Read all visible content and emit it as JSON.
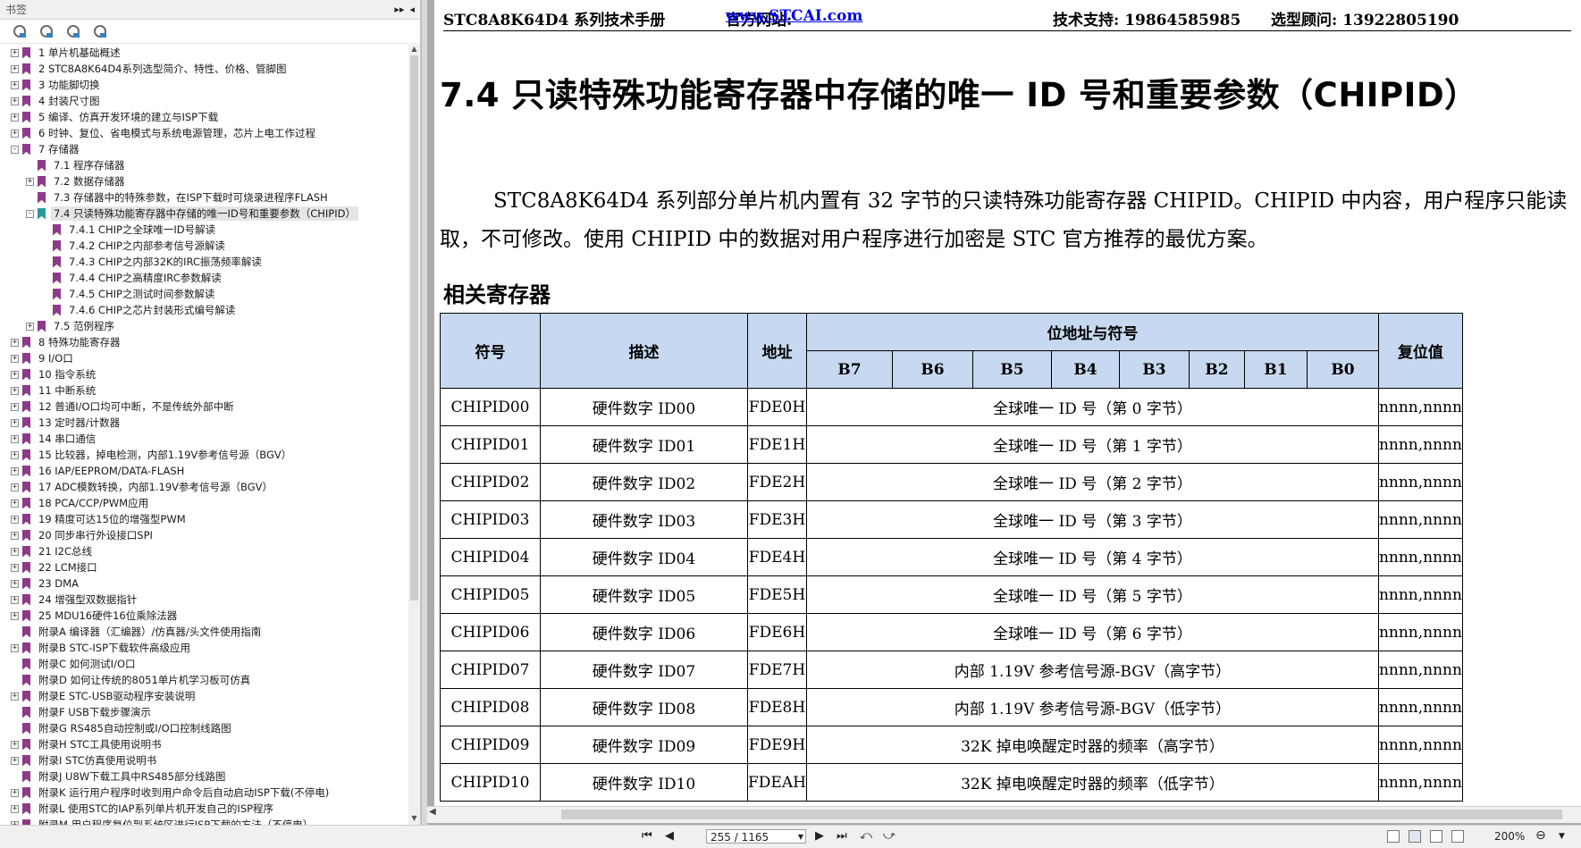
{
  "bookmarks_panel": {
    "title": "书签",
    "items": [
      {
        "label": "1 单片机基础概述",
        "level": 0,
        "expander": "+"
      },
      {
        "label": "2  STC8A8K64D4系列选型简介、特性、价格、管脚图",
        "level": 0,
        "expander": "+"
      },
      {
        "label": "3  功能脚切换",
        "level": 0,
        "expander": "+"
      },
      {
        "label": "4  封装尺寸图",
        "level": 0,
        "expander": "+"
      },
      {
        "label": "5  编译、仿真开发环境的建立与ISP下载",
        "level": 0,
        "expander": "+"
      },
      {
        "label": "6  时钟、复位、省电模式与系统电源管理，芯片上电工作过程",
        "level": 0,
        "expander": "+"
      },
      {
        "label": "7  存储器",
        "level": 0,
        "expander": "-"
      },
      {
        "label": "7.1 程序存储器",
        "level": 1,
        "expander": ""
      },
      {
        "label": "7.2  数据存储器",
        "level": 1,
        "expander": "+"
      },
      {
        "label": "7.3  存储器中的特殊参数，在ISP下载时可烧录进程序FLASH",
        "level": 1,
        "expander": ""
      },
      {
        "label": "7.4  只读特殊功能寄存器中存储的唯一ID号和重要参数（CHIPID）",
        "level": 1,
        "expander": "-",
        "selected": true
      },
      {
        "label": "7.4.1  CHIP之全球唯一ID号解读",
        "level": 2,
        "expander": ""
      },
      {
        "label": "7.4.2 CHIP之内部参考信号源解读",
        "level": 2,
        "expander": ""
      },
      {
        "label": "7.4.3  CHIP之内部32K的IRC振荡频率解读",
        "level": 2,
        "expander": ""
      },
      {
        "label": "7.4.4  CHIP之高精度IRC参数解读",
        "level": 2,
        "expander": ""
      },
      {
        "label": "7.4.5  CHIP之测试时间参数解读",
        "level": 2,
        "expander": ""
      },
      {
        "label": "7.4.6 CHIP之芯片封装形式编号解读",
        "level": 2,
        "expander": ""
      },
      {
        "label": "7.5  范例程序",
        "level": 1,
        "expander": "+"
      },
      {
        "label": "8  特殊功能寄存器",
        "level": 0,
        "expander": "+"
      },
      {
        "label": "9  I/O口",
        "level": 0,
        "expander": "+"
      },
      {
        "label": "10  指令系统",
        "level": 0,
        "expander": "+"
      },
      {
        "label": "11  中断系统",
        "level": 0,
        "expander": "+"
      },
      {
        "label": "12  普通I/O口均可中断，不是传统外部中断",
        "level": 0,
        "expander": "+"
      },
      {
        "label": "13  定时器/计数器",
        "level": 0,
        "expander": "+"
      },
      {
        "label": "14  串口通信",
        "level": 0,
        "expander": "+"
      },
      {
        "label": "15  比较器，掉电检测，内部1.19V参考信号源（BGV）",
        "level": 0,
        "expander": "+"
      },
      {
        "label": "16  IAP/EEPROM/DATA-FLASH",
        "level": 0,
        "expander": "+"
      },
      {
        "label": "17  ADC模数转换，内部1.19V参考信号源（BGV）",
        "level": 0,
        "expander": "+"
      },
      {
        "label": "18  PCA/CCP/PWM应用",
        "level": 0,
        "expander": "+"
      },
      {
        "label": "19  精度可达15位的增强型PWM",
        "level": 0,
        "expander": "+"
      },
      {
        "label": "20 同步串行外设接口SPI",
        "level": 0,
        "expander": "+"
      },
      {
        "label": "21  I2C总线",
        "level": 0,
        "expander": "+"
      },
      {
        "label": "22  LCM接口",
        "level": 0,
        "expander": "+"
      },
      {
        "label": "23  DMA",
        "level": 0,
        "expander": "+"
      },
      {
        "label": "24  增强型双数据指针",
        "level": 0,
        "expander": "+"
      },
      {
        "label": "25  MDU16硬件16位乘除法器",
        "level": 0,
        "expander": "+"
      },
      {
        "label": "附录A  编译器（汇编器）/仿真器/头文件使用指南",
        "level": 0,
        "expander": ""
      },
      {
        "label": "附录B  STC-ISP下载软件高级应用",
        "level": 0,
        "expander": "+"
      },
      {
        "label": "附录C  如何测试I/O口",
        "level": 0,
        "expander": ""
      },
      {
        "label": "附录D  如何让传统的8051单片机学习板可仿真",
        "level": 0,
        "expander": ""
      },
      {
        "label": "附录E  STC-USB驱动程序安装说明",
        "level": 0,
        "expander": "+"
      },
      {
        "label": "附录F  USB下载步骤演示",
        "level": 0,
        "expander": ""
      },
      {
        "label": "附录G  RS485自动控制或I/O口控制线路图",
        "level": 0,
        "expander": ""
      },
      {
        "label": "附录H  STC工具使用说明书",
        "level": 0,
        "expander": "+"
      },
      {
        "label": "附录I  STC仿真使用说明书",
        "level": 0,
        "expander": "+"
      },
      {
        "label": "附录J  U8W下载工具中RS485部分线路图",
        "level": 0,
        "expander": ""
      },
      {
        "label": "附录K  运行用户程序时收到用户命令后自动启动ISP下载(不停电)",
        "level": 0,
        "expander": "+"
      },
      {
        "label": "附录L  使用STC的IAP系列单片机开发自己的ISP程序",
        "level": 0,
        "expander": "+"
      },
      {
        "label": "附录M  用户程序复位到系统区进行ISP下载的方法（不停电）",
        "level": 0,
        "expander": "+"
      }
    ]
  },
  "page": {
    "header": {
      "doc_title": "STC8A8K64D4 系列技术手册",
      "website_label": "官方网站: ",
      "website_url": "www.STCAI.com",
      "support": "技术支持: 19864585985",
      "advisor": "选型顾问: 13922805190"
    },
    "section_title": "7.4   只读特殊功能寄存器中存储的唯一 ID 号和重要参数（CHIPID）",
    "paragraph": "STC8A8K64D4 系列部分单片机内置有 32 字节的只读特殊功能寄存器 CHIPID。CHIPID 中内容，用户程序只能读取，不可修改。使用 CHIPID 中的数据对用户程序进行加密是 STC 官方推荐的最优方案。",
    "subsection_title": "相关寄存器",
    "table": {
      "headers": {
        "symbol": "符号",
        "desc": "描述",
        "addr": "地址",
        "bits_group": "位地址与符号",
        "bits": [
          "B7",
          "B6",
          "B5",
          "B4",
          "B3",
          "B2",
          "B1",
          "B0"
        ],
        "reset": "复位值"
      },
      "rows": [
        {
          "symbol": "CHIPID00",
          "desc": "硬件数字 ID00",
          "addr": "FDE0H",
          "content": "全球唯一 ID 号（第 0 字节）",
          "reset": "nnnn,nnnn"
        },
        {
          "symbol": "CHIPID01",
          "desc": "硬件数字 ID01",
          "addr": "FDE1H",
          "content": "全球唯一 ID 号（第 1 字节）",
          "reset": "nnnn,nnnn"
        },
        {
          "symbol": "CHIPID02",
          "desc": "硬件数字 ID02",
          "addr": "FDE2H",
          "content": "全球唯一 ID 号（第 2 字节）",
          "reset": "nnnn,nnnn"
        },
        {
          "symbol": "CHIPID03",
          "desc": "硬件数字 ID03",
          "addr": "FDE3H",
          "content": "全球唯一 ID 号（第 3 字节）",
          "reset": "nnnn,nnnn"
        },
        {
          "symbol": "CHIPID04",
          "desc": "硬件数字 ID04",
          "addr": "FDE4H",
          "content": "全球唯一 ID 号（第 4 字节）",
          "reset": "nnnn,nnnn"
        },
        {
          "symbol": "CHIPID05",
          "desc": "硬件数字 ID05",
          "addr": "FDE5H",
          "content": "全球唯一 ID 号（第 5 字节）",
          "reset": "nnnn,nnnn"
        },
        {
          "symbol": "CHIPID06",
          "desc": "硬件数字 ID06",
          "addr": "FDE6H",
          "content": "全球唯一 ID 号（第 6 字节）",
          "reset": "nnnn,nnnn"
        },
        {
          "symbol": "CHIPID07",
          "desc": "硬件数字 ID07",
          "addr": "FDE7H",
          "content": "内部 1.19V 参考信号源-BGV（高字节）",
          "reset": "nnnn,nnnn"
        },
        {
          "symbol": "CHIPID08",
          "desc": "硬件数字 ID08",
          "addr": "FDE8H",
          "content": "内部 1.19V 参考信号源-BGV（低字节）",
          "reset": "nnnn,nnnn"
        },
        {
          "symbol": "CHIPID09",
          "desc": "硬件数字 ID09",
          "addr": "FDE9H",
          "content": "32K 掉电唤醒定时器的频率（高字节）",
          "reset": "nnnn,nnnn"
        },
        {
          "symbol": "CHIPID10",
          "desc": "硬件数字 ID10",
          "addr": "FDEAH",
          "content": "32K 掉电唤醒定时器的频率（低字节）",
          "reset": "nnnn,nnnn"
        }
      ]
    }
  },
  "statusbar": {
    "page_indicator": "255 / 1165",
    "zoom": "200%"
  },
  "colors": {
    "bookmark_flag": "#8d3a8a",
    "bookmark_flag_selected": "#2d9a9a",
    "table_header_bg": "#c6d9f0",
    "link": "#0000ee"
  }
}
